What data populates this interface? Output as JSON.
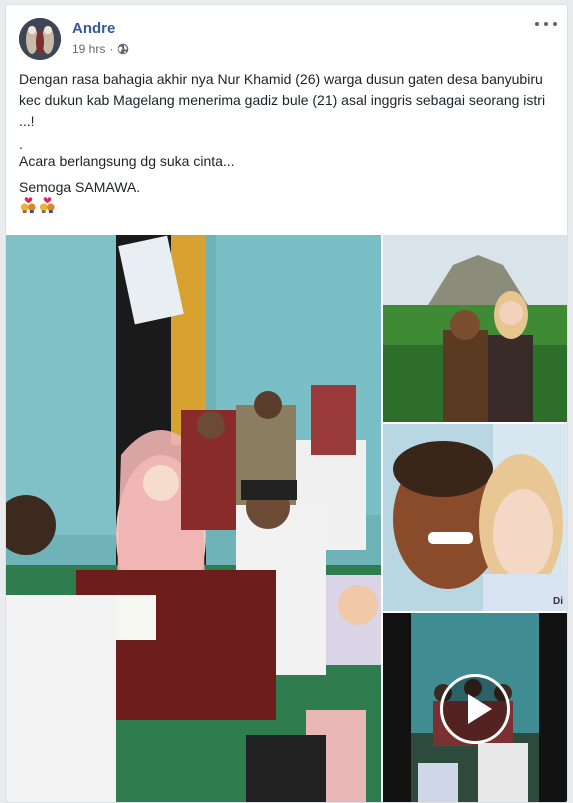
{
  "post": {
    "author": "Andre",
    "timestamp": "19 hrs",
    "privacy_icon": "globe-icon",
    "paragraphs": [
      "Dengan rasa bahagia akhir nya Nur Khamid (26) warga dusun gaten desa banyubiru kec dukun kab Magelang menerima gadiz bule (21) asal inggris sebagai seorang istri ...!",
      ".",
      "Acara berlangsung dg suka cinta...",
      "Semoga SAMAWA."
    ],
    "emoji": [
      "kiss-icon",
      "kiss-icon"
    ]
  },
  "media": {
    "tiles": [
      {
        "name": "wedding-ceremony-photo",
        "kind": "photo"
      },
      {
        "name": "couple-at-temple-photo",
        "kind": "photo"
      },
      {
        "name": "couple-selfie-photo",
        "kind": "photo",
        "watermark": "Di"
      },
      {
        "name": "ceremony-video",
        "kind": "video",
        "control": "play-icon"
      }
    ]
  },
  "colors": {
    "author": "#385898",
    "text": "#1d2129",
    "meta": "#616770",
    "background": "#e9ebee"
  }
}
